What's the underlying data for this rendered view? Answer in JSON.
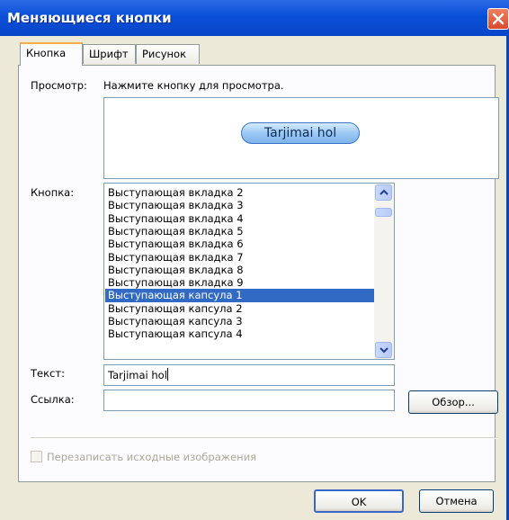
{
  "window": {
    "title": "Меняющиеся кнопки"
  },
  "tabs": [
    {
      "label": "Кнопка",
      "active": true
    },
    {
      "label": "Шрифт",
      "active": false
    },
    {
      "label": "Рисунок",
      "active": false
    }
  ],
  "preview": {
    "label": "Просмотр:",
    "hint": "Нажмите кнопку для просмотра.",
    "button_text": "Tarjimai hol"
  },
  "button_list": {
    "label": "Кнопка:",
    "items": [
      "Выступающая вкладка 2",
      "Выступающая вкладка 3",
      "Выступающая вкладка 4",
      "Выступающая вкладка 5",
      "Выступающая вкладка 6",
      "Выступающая вкладка 7",
      "Выступающая вкладка 8",
      "Выступающая вкладка 9",
      "Выступающая капсула 1",
      "Выступающая капсула 2",
      "Выступающая капсула 3",
      "Выступающая капсула 4"
    ],
    "selected_index": 8
  },
  "text_field": {
    "label": "Текст:",
    "value": "Tarjimai hol"
  },
  "link_field": {
    "label": "Ссылка:",
    "value": "",
    "browse_label": "Обзор..."
  },
  "overwrite": {
    "label": "Перезаписать исходные изображения",
    "checked": false,
    "enabled": false
  },
  "footer": {
    "ok_label": "OK",
    "cancel_label": "Отмена"
  },
  "colors": {
    "titlebar": "#0a4fd8",
    "selection": "#316ac5",
    "capsule": "#9cc9f5"
  },
  "icons": {
    "close": "close-icon",
    "scroll_up": "chevron-up-icon",
    "scroll_down": "chevron-down-icon"
  }
}
